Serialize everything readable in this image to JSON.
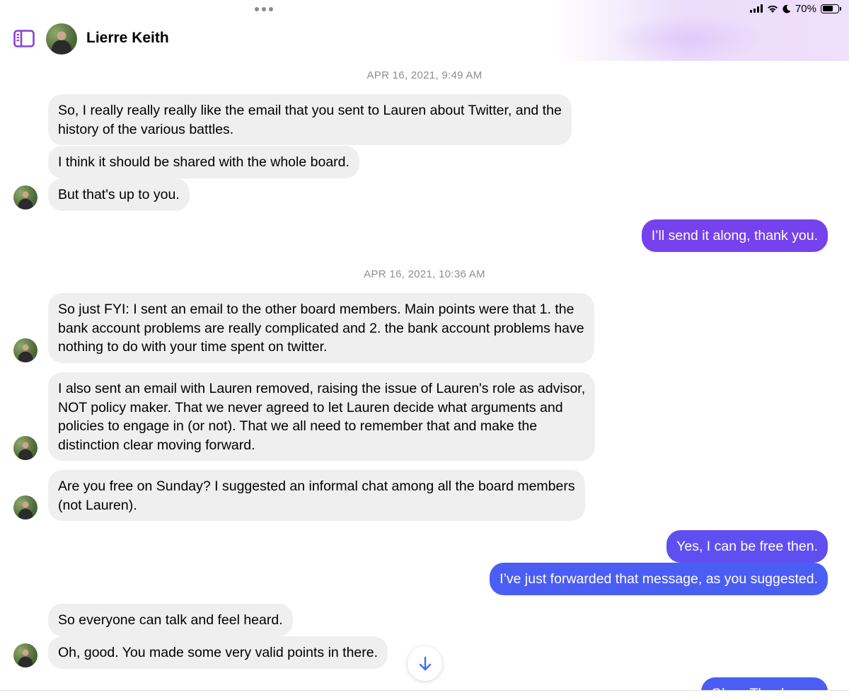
{
  "status_bar": {
    "battery_text": "70%",
    "battery_level": 0.7
  },
  "header": {
    "contact_name": "Lierre Keith"
  },
  "conversation": {
    "timestamp_1": "APR 16, 2021, 9:49 AM",
    "timestamp_2": "APR 16, 2021, 10:36 AM",
    "messages": [
      {
        "sender": "them",
        "lines": [
          "So, I really really really like the email that you sent to Lauren about Twitter, and the",
          "history of the various battles."
        ]
      },
      {
        "sender": "them",
        "lines": [
          "I think it should be shared with the whole board."
        ]
      },
      {
        "sender": "them",
        "lines": [
          "But that's up to you."
        ]
      },
      {
        "sender": "me",
        "lines": [
          "I’ll send it along, thank you."
        ]
      },
      {
        "sender": "them",
        "lines": [
          "So just FYI: I sent an email to the other board members. Main points were that 1. the",
          "bank account problems are really complicated and 2. the bank account problems have",
          "nothing to do with your time spent on twitter."
        ]
      },
      {
        "sender": "them",
        "lines": [
          "I also sent an email with Lauren removed, raising the issue of Lauren's role as advisor,",
          "NOT policy maker. That we never agreed to let Lauren decide what arguments and",
          "policies to engage in (or not). That we all need to remember that and make the",
          "distinction clear moving forward."
        ]
      },
      {
        "sender": "them",
        "lines": [
          "Are you free on Sunday? I suggested an informal chat among all the board members",
          "(not Lauren)."
        ]
      },
      {
        "sender": "me",
        "lines": [
          "Yes, I can be free then."
        ]
      },
      {
        "sender": "me",
        "lines": [
          "I’ve just forwarded that message, as you suggested."
        ]
      },
      {
        "sender": "them",
        "lines": [
          "So everyone can talk and feel heard."
        ]
      },
      {
        "sender": "them",
        "lines": [
          "Oh, good. You made some very valid points in there."
        ]
      },
      {
        "sender": "me",
        "lines": [
          "Okay. Thank you."
        ]
      }
    ]
  },
  "icons": {
    "sidebar_toggle": "sidebar-icon",
    "scroll_down": "arrow-down-icon",
    "wifi": "wifi-icon",
    "moon": "moon-icon",
    "signal": "signal-icon",
    "battery": "battery-icon"
  },
  "colors": {
    "accent": "#8b3fd9",
    "bubble_incoming": "#efefef",
    "bubble_outgoing_purple": "#7542ee",
    "bubble_outgoing_blue": "#4b5ef3",
    "timestamp": "#8e8e93"
  }
}
